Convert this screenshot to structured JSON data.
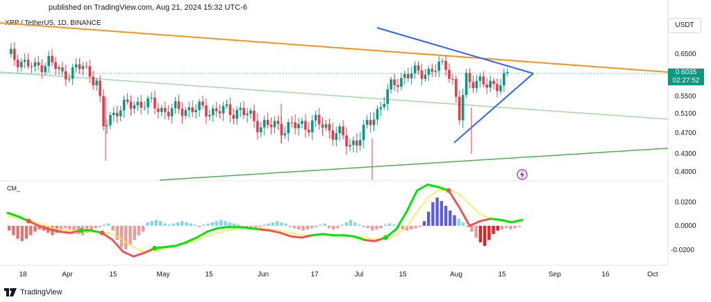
{
  "header": {
    "published": "published on TradingView.com, Aug 21, 2024 15:32 UTC-6",
    "symbol": "XRP / TetherUS, 1D, BINANCE",
    "currency": "USDT"
  },
  "price_tag": {
    "price": "0.6035",
    "countdown": "02:27:52"
  },
  "indicator_label": "CM_",
  "footer": {
    "brand": "TradingView"
  },
  "colors": {
    "up": "#089981",
    "down": "#f23645",
    "orange": "#f7931a",
    "blue": "#2962ff",
    "light_green": "#a5d6a7",
    "dark_green": "#4caf50"
  },
  "chart_data": [
    {
      "type": "candlestick",
      "y_ticks": [
        "0.6500",
        "0.5500",
        "0.5100",
        "0.4700",
        "0.4300",
        "0.4000"
      ],
      "x_ticks": [
        "18",
        "Apr",
        "15",
        "May",
        "15",
        "Jun",
        "17",
        "Jul",
        "15",
        "Aug",
        "15",
        "Sep",
        "16",
        "Oct"
      ],
      "last_price": 0.6035,
      "close_path": [
        [
          0,
          0.65
        ],
        [
          8,
          0.615
        ],
        [
          12,
          0.635
        ],
        [
          16,
          0.6
        ],
        [
          22,
          0.62
        ],
        [
          26,
          0.585
        ],
        [
          28,
          0.48
        ],
        [
          32,
          0.52
        ],
        [
          40,
          0.535
        ],
        [
          46,
          0.515
        ],
        [
          54,
          0.52
        ],
        [
          60,
          0.515
        ],
        [
          68,
          0.515
        ],
        [
          74,
          0.485
        ],
        [
          82,
          0.48
        ],
        [
          90,
          0.49
        ],
        [
          96,
          0.47
        ],
        [
          100,
          0.445
        ],
        [
          104,
          0.47
        ],
        [
          108,
          0.515
        ],
        [
          112,
          0.57
        ],
        [
          116,
          0.6
        ],
        [
          120,
          0.605
        ],
        [
          124,
          0.61
        ],
        [
          128,
          0.625
        ],
        [
          130,
          0.585
        ],
        [
          132,
          0.5
        ],
        [
          134,
          0.59
        ],
        [
          138,
          0.585
        ],
        [
          140,
          0.57
        ],
        [
          144,
          0.583
        ],
        [
          146,
          0.6
        ]
      ],
      "trendlines": [
        {
          "name": "orange-resistance",
          "color": "orange"
        },
        {
          "name": "triangle-upper",
          "color": "blue"
        },
        {
          "name": "triangle-lower",
          "color": "blue"
        },
        {
          "name": "channel-middle",
          "color": "light_green"
        },
        {
          "name": "channel-support",
          "color": "dark_green"
        }
      ]
    },
    {
      "type": "bar",
      "y_ticks": [
        "0.0200",
        "0.0000",
        "-0.0200"
      ],
      "y_values": [
        0.02,
        0.0,
        -0.02
      ],
      "histogram": [
        -0.004,
        -0.008,
        -0.011,
        -0.013,
        -0.011,
        -0.008,
        -0.005,
        -0.003,
        -0.004,
        -0.006,
        -0.008,
        -0.006,
        -0.004,
        -0.002,
        -0.003,
        -0.005,
        -0.007,
        -0.008,
        -0.006,
        -0.004,
        -0.002,
        -0.001,
        0.001,
        0.002,
        -0.004,
        -0.012,
        -0.018,
        -0.02,
        -0.016,
        -0.012,
        -0.008,
        -0.005,
        0.003,
        0.004,
        0.005,
        0.004,
        0.002,
        0.001,
        0.002,
        0.003,
        0.004,
        0.003,
        0.002,
        0.001,
        -0.001,
        0.001,
        0.002,
        0.003,
        0.004,
        0.005,
        0.004,
        0.003,
        0.002,
        0.001,
        -0.001,
        -0.002,
        -0.003,
        -0.002,
        -0.001,
        0.001,
        0.002,
        0.003,
        0.004,
        0.003,
        0.002,
        -0.001,
        -0.002,
        -0.003,
        -0.004,
        -0.003,
        -0.002,
        -0.001,
        0.001,
        0.002,
        -0.002,
        -0.003,
        -0.002,
        0.001,
        0.003,
        0.005,
        0.003,
        0.001,
        -0.001,
        -0.002,
        -0.004,
        -0.003,
        -0.002,
        0.001,
        0.002,
        0.001,
        -0.002,
        -0.003,
        -0.004,
        -0.003,
        -0.002,
        -0.001,
        0.004,
        0.012,
        0.02,
        0.024,
        0.021,
        0.017,
        0.013,
        0.009,
        0.006,
        0.003,
        -0.001,
        -0.005,
        -0.01,
        -0.014,
        -0.017,
        -0.012,
        -0.007,
        -0.004,
        -0.003,
        -0.002,
        -0.003,
        -0.002,
        -0.001
      ],
      "macd_line": [
        0.011,
        0.008,
        0.004,
        0.0,
        -0.003,
        -0.005,
        -0.006,
        -0.004,
        -0.004,
        -0.006,
        -0.012,
        -0.022,
        -0.026,
        -0.023,
        -0.019,
        -0.018,
        -0.017,
        -0.014,
        -0.01,
        -0.005,
        -0.002,
        -0.001,
        -0.001,
        -0.002,
        -0.003,
        -0.004,
        -0.006,
        -0.009,
        -0.01,
        -0.008,
        -0.007,
        -0.008,
        -0.008,
        -0.009,
        -0.012,
        -0.013,
        -0.01,
        -0.003,
        0.012,
        0.03,
        0.035,
        0.033,
        0.03,
        0.016,
        0.0,
        0.004,
        0.006,
        0.005,
        0.003,
        0.005
      ],
      "signal_line": [
        0.008,
        0.007,
        0.005,
        0.002,
        -0.001,
        -0.003,
        -0.004,
        -0.005,
        -0.005,
        -0.005,
        -0.007,
        -0.012,
        -0.018,
        -0.022,
        -0.021,
        -0.019,
        -0.017,
        -0.015,
        -0.012,
        -0.009,
        -0.006,
        -0.004,
        -0.002,
        -0.002,
        -0.002,
        -0.003,
        -0.004,
        -0.006,
        -0.008,
        -0.008,
        -0.008,
        -0.008,
        -0.008,
        -0.009,
        -0.01,
        -0.011,
        -0.011,
        -0.008,
        -0.001,
        0.012,
        0.024,
        0.03,
        0.031,
        0.027,
        0.018,
        0.01,
        0.006,
        0.004,
        0.003,
        0.004
      ]
    }
  ]
}
